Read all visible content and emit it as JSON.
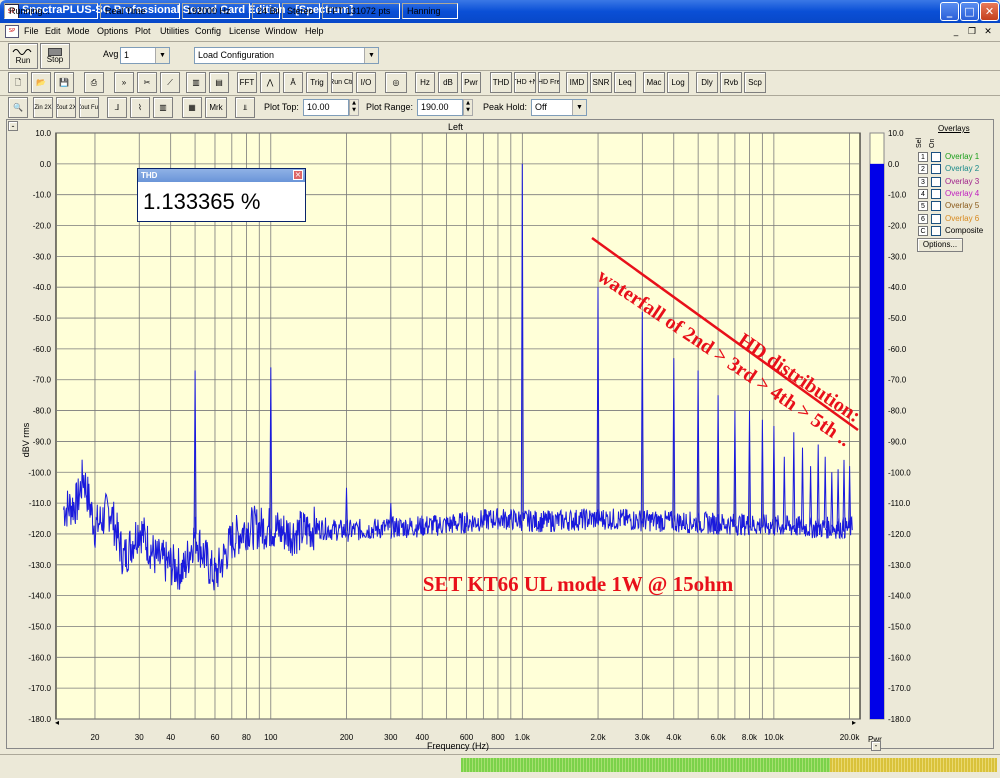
{
  "window": {
    "title": "SpectraPLUS-SC Professional Sound Card Edition - [Spectrum]",
    "app_icon_label": "SP"
  },
  "menubar": {
    "items": [
      "File",
      "Edit",
      "Mode",
      "Options",
      "Plot",
      "Utilities",
      "Config",
      "License",
      "Window",
      "Help"
    ]
  },
  "toolbar1": {
    "run_label": "Run",
    "stop_label": "Stop",
    "avg_label": "Avg",
    "avg_value": "1",
    "config_value": "Load Configuration"
  },
  "toolbar2": {
    "buttons": [
      "FFT",
      "Trig",
      "Run Ctrl",
      "I/O",
      "Hz",
      "dB",
      "Pwr",
      "THD",
      "THD +N",
      "THD Freq",
      "IMD",
      "SNR",
      "Leq",
      "Mac",
      "Log",
      "Dly",
      "Rvb",
      "Scp"
    ]
  },
  "toolbar3": {
    "zoom_buttons": [
      "Zin 2X",
      "Zout 2X",
      "Zout Full"
    ],
    "mrk_label": "Mrk",
    "plot_top_label": "Plot Top:",
    "plot_top_value": "10.00",
    "plot_range_label": "Plot Range:",
    "plot_range_value": "190.00",
    "peak_hold_label": "Peak Hold:",
    "peak_hold_value": "Off"
  },
  "plot": {
    "collapse_label": "-",
    "channel_label": "Left",
    "ylabel": "dBV rms",
    "xlabel": "Frequency (Hz)",
    "right_label": "Pwr"
  },
  "thd_window": {
    "caption": "THD",
    "value": "1.133365 %"
  },
  "overlays": {
    "title": "Overlays",
    "sel_label": "Sel",
    "on_label": "On",
    "items": [
      {
        "num": "1",
        "label": "Overlay 1",
        "color": "#1a9e1a"
      },
      {
        "num": "2",
        "label": "Overlay 2",
        "color": "#1a8a8a"
      },
      {
        "num": "3",
        "label": "Overlay 3",
        "color": "#a0228c"
      },
      {
        "num": "4",
        "label": "Overlay 4",
        "color": "#c020c0"
      },
      {
        "num": "5",
        "label": "Overlay 5",
        "color": "#8a5a1a"
      },
      {
        "num": "6",
        "label": "Overlay 6",
        "color": "#d88a20"
      },
      {
        "num": "C",
        "label": "Composite",
        "color": "#000000"
      }
    ],
    "options_label": "Options..."
  },
  "annotations": {
    "hd_line1": "HD distribution:",
    "hd_line2": "waterfall of 2nd > 3rd > 4th > 5th ..",
    "caption": "SET KT66 UL mode 1W @ 15ohm",
    "color": "#e8101a"
  },
  "status": {
    "state": "Running...",
    "mode": "Real Time",
    "rate": "192000 Hz",
    "bits": "24 Bit",
    "channels": "Stereo",
    "fft": "FFT 131072 pts",
    "window": "Hanning"
  },
  "chart_data": {
    "type": "line",
    "title": "Left",
    "xlabel": "Frequency (Hz)",
    "ylabel": "dBV rms",
    "x_scale": "log",
    "xlim": [
      14,
      22000
    ],
    "ylim": [
      -180,
      10
    ],
    "x_ticks": [
      20,
      30,
      40,
      50,
      60,
      80,
      100,
      200,
      300,
      400,
      600,
      800,
      1000,
      2000,
      3000,
      4000,
      6000,
      8000,
      10000,
      20000
    ],
    "x_tick_labels": [
      "20",
      "30",
      "40",
      "",
      "60",
      "80",
      "100",
      "200",
      "300",
      "400",
      "600",
      "800",
      "1.0k",
      "2.0k",
      "3.0k",
      "4.0k",
      "6.0k",
      "8.0k",
      "10.0k",
      "20.0k"
    ],
    "y_ticks": [
      10,
      0,
      -10,
      -20,
      -30,
      -40,
      -50,
      -60,
      -70,
      -80,
      -90,
      -100,
      -110,
      -120,
      -130,
      -140,
      -150,
      -160,
      -170,
      -180
    ],
    "y_tick_labels": [
      "10.0",
      "0.0",
      "-10.0",
      "-20.0",
      "-30.0",
      "-40.0",
      "-50.0",
      "-60.0",
      "-70.0",
      "-80.0",
      "-90.0",
      "-100.0",
      "-110.0",
      "-120.0",
      "-130.0",
      "-140.0",
      "-150.0",
      "-160.0",
      "-170.0",
      "-180.0"
    ],
    "grid": true,
    "noise_floor": [
      [
        15,
        -112
      ],
      [
        17,
        -110
      ],
      [
        18,
        -101
      ],
      [
        19,
        -110
      ],
      [
        20,
        -118
      ],
      [
        23,
        -112
      ],
      [
        26,
        -128
      ],
      [
        30,
        -118
      ],
      [
        35,
        -128
      ],
      [
        40,
        -130
      ],
      [
        45,
        -132
      ],
      [
        50,
        -120
      ],
      [
        55,
        -128
      ],
      [
        60,
        -134
      ],
      [
        70,
        -122
      ],
      [
        80,
        -118
      ],
      [
        100,
        -118
      ],
      [
        120,
        -120
      ],
      [
        150,
        -118
      ],
      [
        200,
        -119
      ],
      [
        300,
        -118
      ],
      [
        500,
        -117
      ],
      [
        800,
        -115
      ],
      [
        1200,
        -116
      ],
      [
        2000,
        -115
      ],
      [
        4000,
        -116
      ],
      [
        8000,
        -117
      ],
      [
        15000,
        -118
      ],
      [
        20000,
        -118
      ]
    ],
    "peaks": [
      {
        "freq": 50,
        "level": -67
      },
      {
        "freq": 100,
        "level": -66
      },
      {
        "freq": 200,
        "level": -105
      },
      {
        "freq": 300,
        "level": -110
      },
      {
        "freq": 1000,
        "level": 0
      },
      {
        "freq": 2000,
        "level": -40
      },
      {
        "freq": 3000,
        "level": -48
      },
      {
        "freq": 4000,
        "level": -63
      },
      {
        "freq": 5000,
        "level": -67
      },
      {
        "freq": 6000,
        "level": -75
      },
      {
        "freq": 7000,
        "level": -80
      },
      {
        "freq": 8000,
        "level": -80
      },
      {
        "freq": 9000,
        "level": -83
      },
      {
        "freq": 10000,
        "level": -85
      },
      {
        "freq": 11000,
        "level": -95
      },
      {
        "freq": 12000,
        "level": -87
      },
      {
        "freq": 13000,
        "level": -92
      },
      {
        "freq": 14000,
        "level": -98
      },
      {
        "freq": 15000,
        "level": -91
      },
      {
        "freq": 16000,
        "level": -95
      },
      {
        "freq": 17000,
        "level": -100
      },
      {
        "freq": 18000,
        "level": -99
      },
      {
        "freq": 19000,
        "level": -96
      },
      {
        "freq": 20000,
        "level": -98
      }
    ],
    "pwr_meter_level": 0
  }
}
